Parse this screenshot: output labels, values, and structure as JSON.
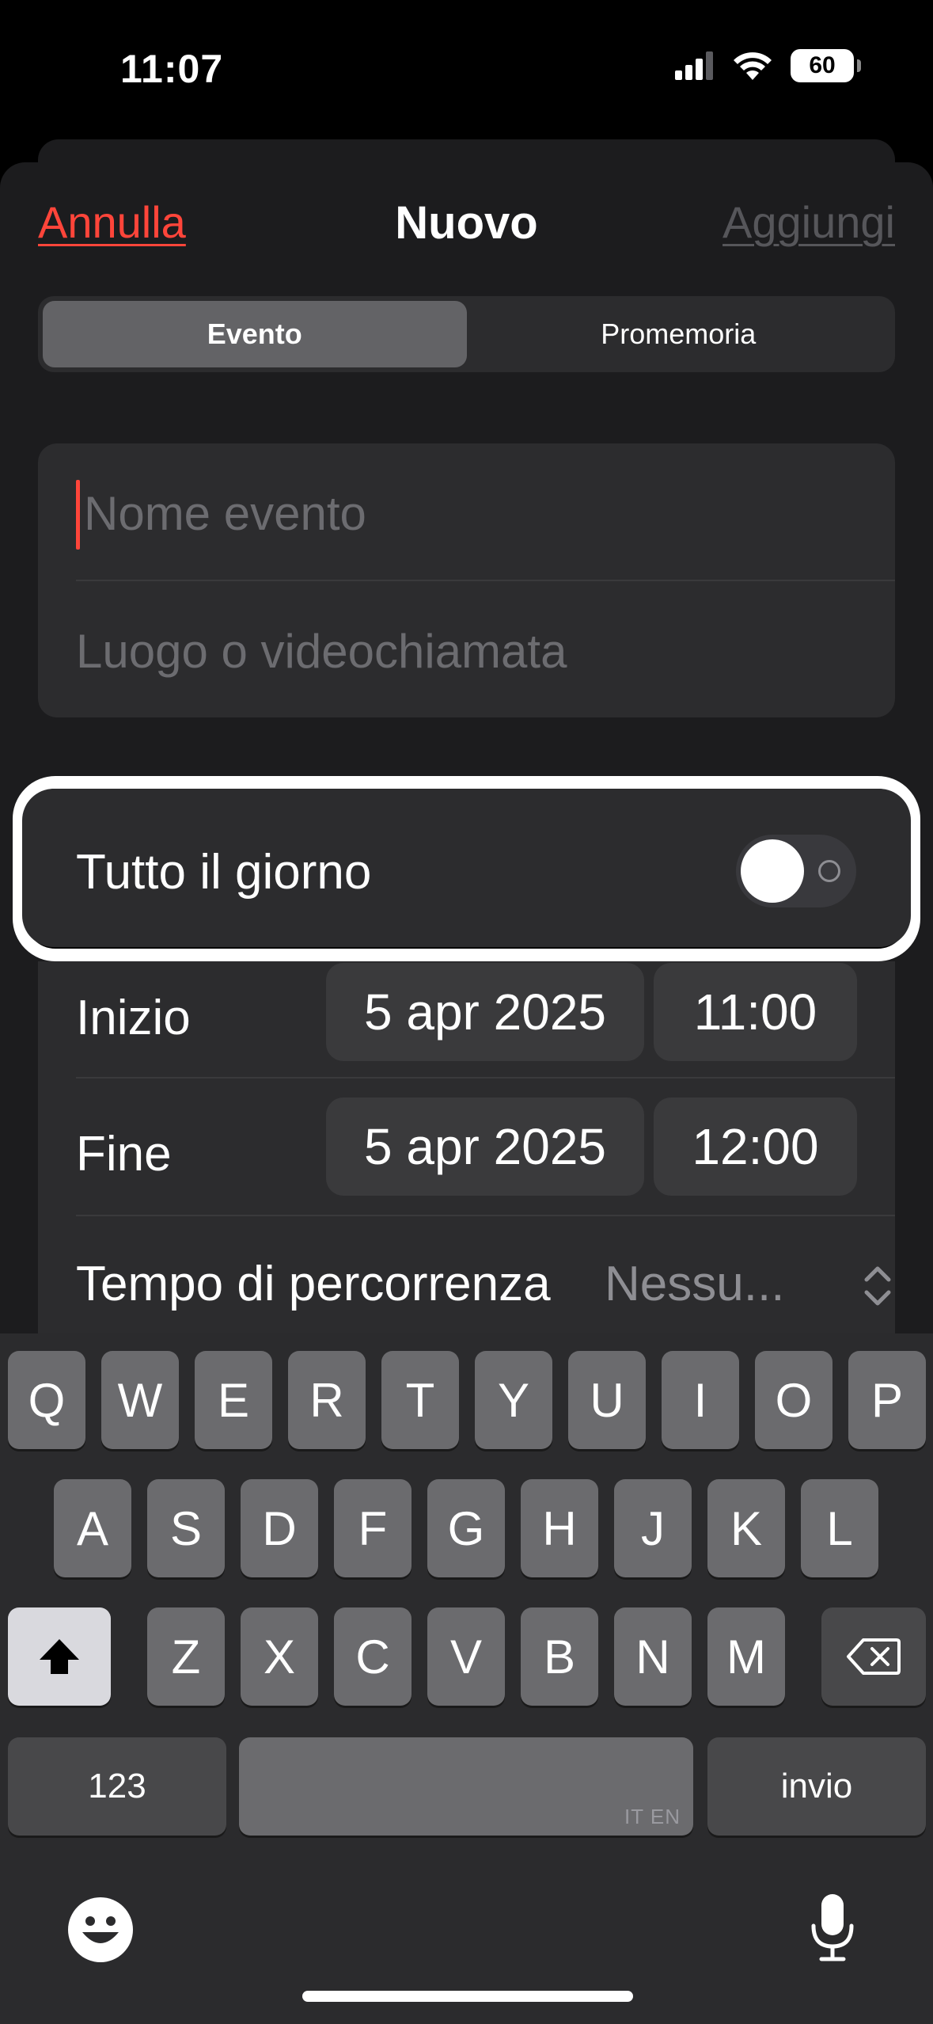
{
  "status_bar": {
    "time": "11:07",
    "battery": "60"
  },
  "nav": {
    "cancel_label": "Annulla",
    "title": "Nuovo",
    "add_label": "Aggiungi"
  },
  "segments": [
    {
      "label": "Evento",
      "selected": true
    },
    {
      "label": "Promemoria",
      "selected": false
    }
  ],
  "form": {
    "name_placeholder": "Nome evento",
    "location_placeholder": "Luogo o videochiamata",
    "all_day_label": "Tutto il giorno",
    "all_day_on": false,
    "start": {
      "label": "Inizio",
      "date": "5 apr 2025",
      "time": "11:00"
    },
    "end": {
      "label": "Fine",
      "date": "5 apr 2025",
      "time": "12:00"
    },
    "travel_time": {
      "label": "Tempo di percorrenza",
      "value": "Nessu..."
    }
  },
  "keyboard": {
    "row1": [
      "Q",
      "W",
      "E",
      "R",
      "T",
      "Y",
      "U",
      "I",
      "O",
      "P"
    ],
    "row2": [
      "A",
      "S",
      "D",
      "F",
      "G",
      "H",
      "J",
      "K",
      "L"
    ],
    "row3": [
      "Z",
      "X",
      "C",
      "V",
      "B",
      "N",
      "M"
    ],
    "numbers_label": "123",
    "return_label": "invio",
    "language_hint": "IT EN"
  },
  "colors": {
    "accent": "#ff453a",
    "sheet": "#1c1c1e",
    "cell": "#2c2c2e"
  }
}
